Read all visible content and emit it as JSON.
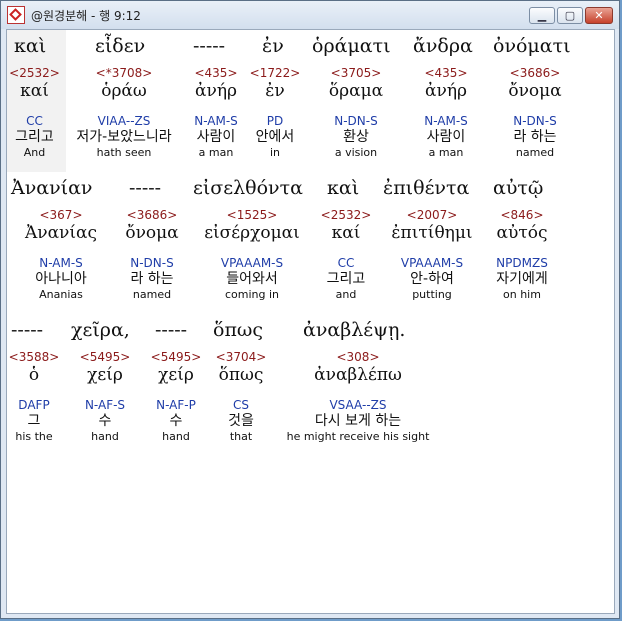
{
  "window": {
    "title": "@원경분해 - 행 9:12"
  },
  "controls": {
    "minimize": "▁",
    "maximize": "▢",
    "close": "✕"
  },
  "rows": [
    {
      "greek": [
        "καὶ",
        "εἶδεν",
        "-----",
        "ἐν",
        "ὁράματι",
        "ἄνδρα",
        "ὀνόματι"
      ],
      "words": [
        {
          "num": "<2532>",
          "lemma": "καί",
          "parse": "CC",
          "kor": "그리고",
          "eng": "And"
        },
        {
          "num": "<*3708>",
          "lemma": "ὁράω",
          "parse": "VIAA--ZS",
          "kor": "저가-보았느니라",
          "eng": "hath seen"
        },
        {
          "num": "<435>",
          "lemma": "ἀνήρ",
          "parse": "N-AM-S",
          "kor": "사람이",
          "eng": "a man"
        },
        {
          "num": "<1722>",
          "lemma": "ἐν",
          "parse": "PD",
          "kor": "안에서",
          "eng": "in"
        },
        {
          "num": "<3705>",
          "lemma": "ὅραμα",
          "parse": "N-DN-S",
          "kor": "환상",
          "eng": "a vision"
        },
        {
          "num": "<435>",
          "lemma": "ἀνήρ",
          "parse": "N-AM-S",
          "kor": "사람이",
          "eng": "a man"
        },
        {
          "num": "<3686>",
          "lemma": "ὄνομα",
          "parse": "N-DN-S",
          "kor": "라 하는",
          "eng": "named"
        }
      ]
    },
    {
      "greek": [
        "Ἀνανίαν",
        "-----",
        "εἰσελθόντα",
        "καὶ",
        "ἐπιθέντα",
        "αὐτῷ"
      ],
      "words": [
        {
          "num": "<367>",
          "lemma": "Ἀνανίας",
          "parse": "N-AM-S",
          "kor": "아나니아",
          "eng": "Ananias"
        },
        {
          "num": "<3686>",
          "lemma": "ὄνομα",
          "parse": "N-DN-S",
          "kor": "라 하는",
          "eng": "named"
        },
        {
          "num": "<1525>",
          "lemma": "εἰσέρχομαι",
          "parse": "VPAAAM-S",
          "kor": "들어와서",
          "eng": "coming in"
        },
        {
          "num": "<2532>",
          "lemma": "καί",
          "parse": "CC",
          "kor": "그리고",
          "eng": "and"
        },
        {
          "num": "<2007>",
          "lemma": "ἐπιτίθημι",
          "parse": "VPAAAM-S",
          "kor": "안-하여",
          "eng": "putting"
        },
        {
          "num": "<846>",
          "lemma": "αὐτός",
          "parse": "NPDMZS",
          "kor": "자기에게",
          "eng": "on him"
        }
      ]
    },
    {
      "greek": [
        "-----",
        "χεῖρα,",
        "-----",
        "ὅπως",
        "ἀναβλέψῃ."
      ],
      "words": [
        {
          "num": "<3588>",
          "lemma": "ὁ",
          "parse": "DAFP",
          "kor": "그",
          "eng": "his the"
        },
        {
          "num": "<5495>",
          "lemma": "χείρ",
          "parse": "N-AF-S",
          "kor": "수",
          "eng": "hand"
        },
        {
          "num": "<5495>",
          "lemma": "χείρ",
          "parse": "N-AF-P",
          "kor": "수",
          "eng": "hand"
        },
        {
          "num": "<3704>",
          "lemma": "ὅπως",
          "parse": "CS",
          "kor": "것을",
          "eng": "that"
        },
        {
          "num": "<308>",
          "lemma": "ἀναβλέπω",
          "parse": "VSAA--ZS",
          "kor": "다시 보게 하는",
          "eng": "he might receive his sight"
        }
      ]
    }
  ]
}
